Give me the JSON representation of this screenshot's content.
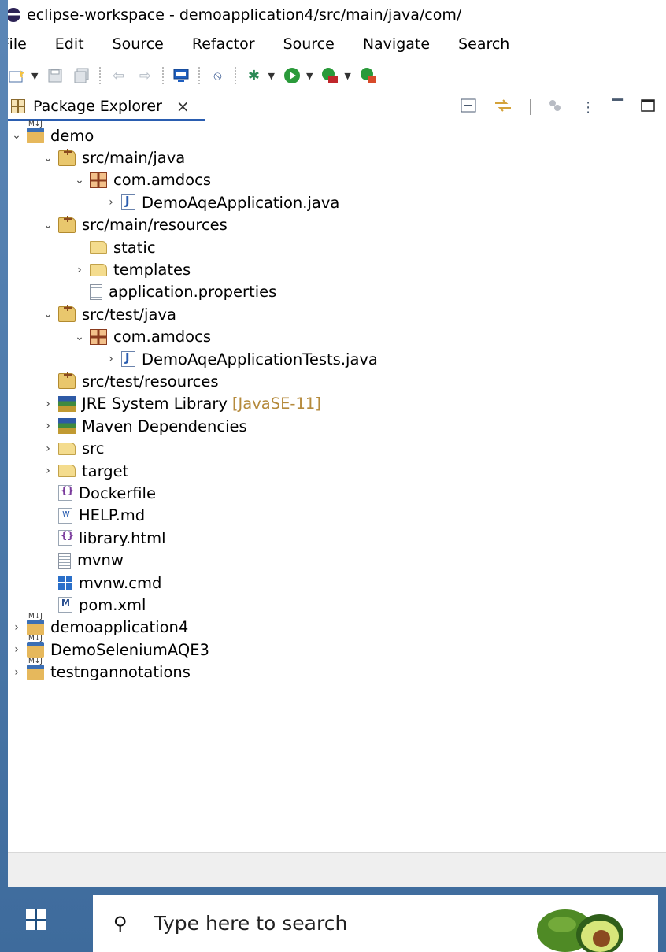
{
  "window": {
    "title": "eclipse-workspace - demoapplication4/src/main/java/com/"
  },
  "menu": [
    "File",
    "Edit",
    "Source",
    "Refactor",
    "Source",
    "Navigate",
    "Search"
  ],
  "toolbar_icons": [
    "new-wizard-icon",
    "save-icon",
    "save-all-icon",
    "undo-icon",
    "redo-icon",
    "console-icon",
    "skip-breakpoints-icon",
    "debug-icon",
    "run-icon",
    "run-coverage-icon",
    "external-tools-icon"
  ],
  "view": {
    "tab_label": "Package Explorer",
    "close_glyph": "×"
  },
  "tree": [
    {
      "depth": 0,
      "chev": "⌄",
      "icon": "project",
      "label": "demo",
      "name": "tree-item-demo"
    },
    {
      "depth": 1,
      "chev": "⌄",
      "icon": "srcfolder",
      "label": "src/main/java",
      "name": "tree-item-src-main-java"
    },
    {
      "depth": 2,
      "chev": "⌄",
      "icon": "package",
      "label": "com.amdocs",
      "name": "tree-item-com-amdocs"
    },
    {
      "depth": 3,
      "chev": "›",
      "icon": "java",
      "label": "DemoAqeApplication.java",
      "name": "tree-item-demoaqeapplication-java"
    },
    {
      "depth": 1,
      "chev": "⌄",
      "icon": "srcfolder",
      "label": "src/main/resources",
      "name": "tree-item-src-main-resources"
    },
    {
      "depth": 2,
      "chev": "",
      "icon": "folder",
      "label": "static",
      "name": "tree-item-static"
    },
    {
      "depth": 2,
      "chev": "›",
      "icon": "folder",
      "label": "templates",
      "name": "tree-item-templates"
    },
    {
      "depth": 2,
      "chev": "",
      "icon": "file",
      "label": "application.properties",
      "name": "tree-item-application-properties"
    },
    {
      "depth": 1,
      "chev": "⌄",
      "icon": "srcfolder",
      "label": "src/test/java",
      "name": "tree-item-src-test-java"
    },
    {
      "depth": 2,
      "chev": "⌄",
      "icon": "package",
      "label": "com.amdocs",
      "name": "tree-item-com-amdocs-test"
    },
    {
      "depth": 3,
      "chev": "›",
      "icon": "java",
      "label": "DemoAqeApplicationTests.java",
      "name": "tree-item-demoaqeapplicationtests-java"
    },
    {
      "depth": 1,
      "chev": "",
      "icon": "srcfolder",
      "label": "src/test/resources",
      "name": "tree-item-src-test-resources"
    },
    {
      "depth": 1,
      "chev": "›",
      "icon": "lib",
      "label": "JRE System Library",
      "deco": "[JavaSE-11]",
      "name": "tree-item-jre-system-library"
    },
    {
      "depth": 1,
      "chev": "›",
      "icon": "lib",
      "label": "Maven Dependencies",
      "name": "tree-item-maven-dependencies"
    },
    {
      "depth": 1,
      "chev": "›",
      "icon": "folder",
      "label": "src",
      "name": "tree-item-src"
    },
    {
      "depth": 1,
      "chev": "›",
      "icon": "folder",
      "label": "target",
      "name": "tree-item-target"
    },
    {
      "depth": 1,
      "chev": "",
      "icon": "brace",
      "label": "Dockerfile",
      "name": "tree-item-dockerfile"
    },
    {
      "depth": 1,
      "chev": "",
      "icon": "w",
      "label": "HELP.md",
      "name": "tree-item-help-md"
    },
    {
      "depth": 1,
      "chev": "",
      "icon": "brace",
      "label": "library.html",
      "name": "tree-item-library-html"
    },
    {
      "depth": 1,
      "chev": "",
      "icon": "file",
      "label": "mvnw",
      "name": "tree-item-mvnw"
    },
    {
      "depth": 1,
      "chev": "",
      "icon": "cmd",
      "label": "mvnw.cmd",
      "name": "tree-item-mvnw-cmd"
    },
    {
      "depth": 1,
      "chev": "",
      "icon": "m",
      "label": "pom.xml",
      "name": "tree-item-pom-xml"
    },
    {
      "depth": 0,
      "chev": "›",
      "icon": "project",
      "label": "demoapplication4",
      "name": "tree-item-demoapplication4"
    },
    {
      "depth": 0,
      "chev": "›",
      "icon": "project",
      "label": "DemoSeleniumAQE3",
      "name": "tree-item-demoseleniumaqe3"
    },
    {
      "depth": 0,
      "chev": "›",
      "icon": "project",
      "label": "testngannotations",
      "name": "tree-item-testngannotations"
    }
  ],
  "taskbar": {
    "search_placeholder": "Type here to search"
  }
}
